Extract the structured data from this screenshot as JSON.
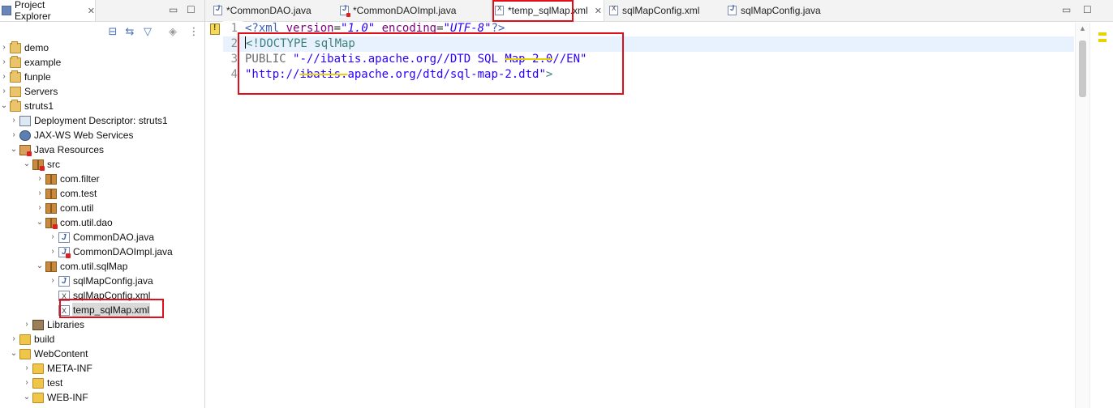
{
  "explorer": {
    "title": "Project Explorer",
    "close_glyph": "✕",
    "minimize_glyph": "▭",
    "maximize_glyph": "☐",
    "toolbar": {
      "collapse_all": "⊟",
      "link_editor": "⇆",
      "filter": "▽",
      "sync": "◈",
      "menu": "⋮"
    },
    "tree": [
      {
        "label": "demo"
      },
      {
        "label": "example"
      },
      {
        "label": "funple"
      },
      {
        "label": "Servers"
      },
      {
        "label": "struts1"
      },
      {
        "label": "Deployment Descriptor: struts1"
      },
      {
        "label": "JAX-WS Web Services"
      },
      {
        "label": "Java Resources"
      },
      {
        "label": "src"
      },
      {
        "label": "com.filter"
      },
      {
        "label": "com.test"
      },
      {
        "label": "com.util"
      },
      {
        "label": "com.util.dao"
      },
      {
        "label": "CommonDAO.java"
      },
      {
        "label": "CommonDAOImpl.java"
      },
      {
        "label": "com.util.sqlMap"
      },
      {
        "label": "sqlMapConfig.java"
      },
      {
        "label": "sqlMapConfig.xml"
      },
      {
        "label": "temp_sqlMap.xml"
      },
      {
        "label": "Libraries"
      },
      {
        "label": "build"
      },
      {
        "label": "WebContent"
      },
      {
        "label": "META-INF"
      },
      {
        "label": "test"
      },
      {
        "label": "WEB-INF"
      }
    ]
  },
  "editor": {
    "tabs": [
      {
        "label": "*CommonDAO.java"
      },
      {
        "label": "*CommonDAOImpl.java"
      },
      {
        "label": "*temp_sqlMap.xml"
      },
      {
        "label": "sqlMapConfig.xml"
      },
      {
        "label": "sqlMapConfig.java"
      }
    ],
    "active_tab_close": "✕",
    "line_numbers": [
      "1",
      "2",
      "3",
      "4"
    ],
    "lines": {
      "l1": {
        "pi_open": "<?xml ",
        "attr1": "version",
        "eq1": "=",
        "val1": "\"1.0\"",
        "sp": " ",
        "attr2": "encoding",
        "eq2": "=",
        "val2": "\"UTF-8\"",
        "pi_close": "?>"
      },
      "l2": {
        "text": "<!DOCTYPE sqlMap"
      },
      "l3": {
        "kw": "PUBLIC ",
        "str_a": "\"-//ibatis.apache.org//DTD SQL ",
        "str_b": "Map 2.0",
        "str_c": "//EN\""
      },
      "l4": {
        "str_a": "\"http://",
        "str_b": "ibatis.",
        "str_c": "apache.org/dtd/sql-map-2.dtd\"",
        "close": ">"
      }
    },
    "minimize_glyph": "▭",
    "maximize_glyph": "☐"
  },
  "colors": {
    "highlight_box": "#e0101a",
    "current_line": "#e8f2fe",
    "warning_underline": "#e8d200"
  }
}
